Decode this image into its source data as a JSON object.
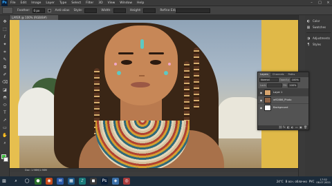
{
  "menubar": {
    "logo": "Ps",
    "items": [
      "File",
      "Edit",
      "Image",
      "Layer",
      "Type",
      "Select",
      "Filter",
      "3D",
      "View",
      "Window",
      "Help"
    ],
    "window_controls": [
      "–",
      "□",
      "×"
    ]
  },
  "options": {
    "feather_label": "Feather:",
    "feather_value": "0 px",
    "antialias_label": "Anti-alias",
    "style_label": "Style:",
    "width_label": "Width:",
    "height_label": "Height:",
    "refine_label": "Refine Edge..."
  },
  "document": {
    "tab_label": "LAYER @ 100% (RGB/8#)",
    "status": "Doc: 1.98M/1.98M"
  },
  "tools": [
    "✥",
    "⬚",
    "ℓ",
    "✦",
    "⌗",
    "✎",
    "⧉",
    "✐",
    "⌫",
    "◪",
    "◓",
    "⬭",
    "T",
    "➚",
    "▭",
    "✋",
    "⌕"
  ],
  "dock": {
    "items": [
      {
        "icon": "◐",
        "label": "Color"
      },
      {
        "icon": "▦",
        "label": "Swatches"
      },
      {
        "icon": "◑",
        "label": "Adjustments"
      },
      {
        "icon": "¶",
        "label": "Styles"
      }
    ]
  },
  "layers_panel": {
    "tabs": [
      "Layers",
      "Channels",
      "Paths"
    ],
    "blend_mode": "Normal",
    "opacity_label": "Opacity:",
    "opacity_value": "100%",
    "lock_label": "Lock:",
    "fill_label": "Fill:",
    "fill_value": "100%",
    "layers": [
      {
        "name": "Layer 1",
        "thumb_color": "#d7a56f"
      },
      {
        "name": "w92886_Photo",
        "thumb_color": "#8d6448"
      },
      {
        "name": "Background",
        "thumb_color": "#ffffff"
      }
    ],
    "bottom_icons": [
      "⛓",
      "fx",
      "◧",
      "◐",
      "▭",
      "▣",
      "🗑"
    ]
  },
  "taskbar": {
    "start": "⊞",
    "apps": [
      {
        "icon": "⌕",
        "color": "#1b2b3a"
      },
      {
        "icon": "◯",
        "color": "#1b2b3a"
      },
      {
        "icon": "●",
        "color": "#2a6f2a"
      },
      {
        "icon": "◉",
        "color": "#c84a1a"
      },
      {
        "icon": "✉",
        "color": "#2b5aa8"
      },
      {
        "icon": "▦",
        "color": "#1f5a8a"
      },
      {
        "icon": "♪",
        "color": "#1a7a7a"
      },
      {
        "icon": "◼",
        "color": "#3a3a3a"
      },
      {
        "icon": "Ps",
        "color": "#0a1f3a"
      },
      {
        "icon": "◈",
        "color": "#3a6fa8"
      },
      {
        "icon": "◎",
        "color": "#a83a3a"
      }
    ],
    "weather": "24°C",
    "tray_text": "В осн. облачно",
    "lang": "РУС",
    "time": "17:52",
    "date": "08.07.2021"
  }
}
